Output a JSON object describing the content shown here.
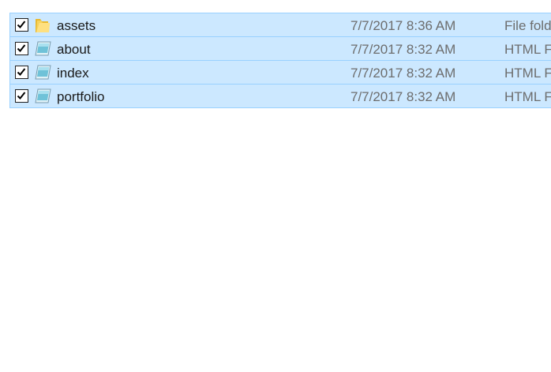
{
  "files": [
    {
      "name": "assets",
      "date": "7/7/2017 8:36 AM",
      "type": "File folder",
      "icon": "folder-icon",
      "checked": true
    },
    {
      "name": "about",
      "date": "7/7/2017 8:32 AM",
      "type": "HTML File",
      "icon": "html-file-icon",
      "checked": true
    },
    {
      "name": "index",
      "date": "7/7/2017 8:32 AM",
      "type": "HTML File",
      "icon": "html-file-icon",
      "checked": true
    },
    {
      "name": "portfolio",
      "date": "7/7/2017 8:32 AM",
      "type": "HTML File",
      "icon": "html-file-icon",
      "checked": true
    }
  ],
  "colors": {
    "selection_bg": "#cce8ff",
    "selection_border": "#99d1ff"
  }
}
